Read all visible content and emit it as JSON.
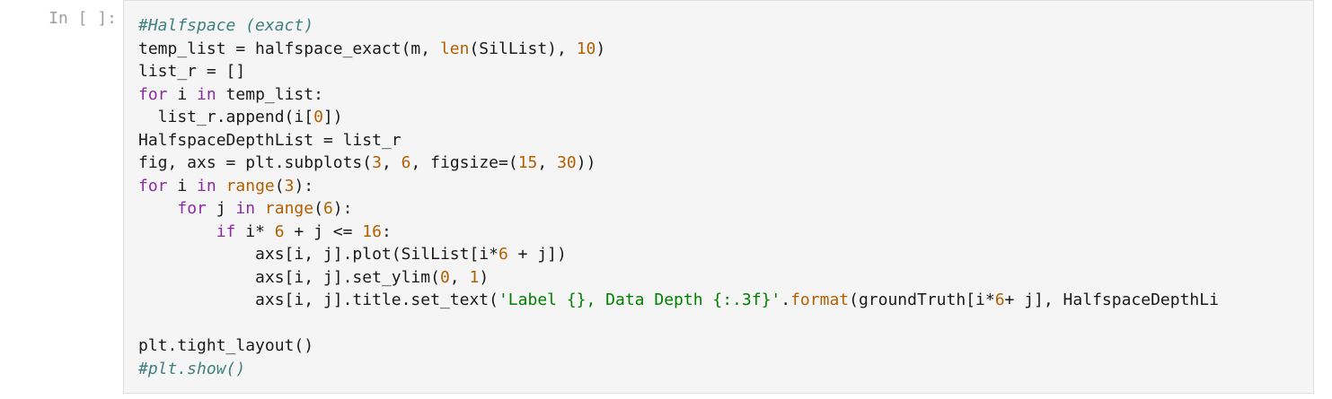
{
  "cell": {
    "prompt": "In [ ]:",
    "lines": [
      [
        {
          "t": "#Halfspace (exact)",
          "k": "comment"
        }
      ],
      [
        {
          "t": "temp_list = halfspace_exact(m, ",
          "k": "plain"
        },
        {
          "t": "len",
          "k": "builtin"
        },
        {
          "t": "(SilList), ",
          "k": "plain"
        },
        {
          "t": "10",
          "k": "number"
        },
        {
          "t": ")",
          "k": "plain"
        }
      ],
      [
        {
          "t": "list_r = []",
          "k": "plain"
        }
      ],
      [
        {
          "t": "for",
          "k": "keyword"
        },
        {
          "t": " i ",
          "k": "plain"
        },
        {
          "t": "in",
          "k": "keyword"
        },
        {
          "t": " temp_list:",
          "k": "plain"
        }
      ],
      [
        {
          "t": "  list_r.append(i[",
          "k": "plain"
        },
        {
          "t": "0",
          "k": "number"
        },
        {
          "t": "])",
          "k": "plain"
        }
      ],
      [
        {
          "t": "HalfspaceDepthList = list_r",
          "k": "plain"
        }
      ],
      [
        {
          "t": "fig, axs = plt.subplots(",
          "k": "plain"
        },
        {
          "t": "3",
          "k": "number"
        },
        {
          "t": ", ",
          "k": "plain"
        },
        {
          "t": "6",
          "k": "number"
        },
        {
          "t": ", figsize=(",
          "k": "plain"
        },
        {
          "t": "15",
          "k": "number"
        },
        {
          "t": ", ",
          "k": "plain"
        },
        {
          "t": "30",
          "k": "number"
        },
        {
          "t": "))",
          "k": "plain"
        }
      ],
      [
        {
          "t": "for",
          "k": "keyword"
        },
        {
          "t": " i ",
          "k": "plain"
        },
        {
          "t": "in",
          "k": "keyword"
        },
        {
          "t": " ",
          "k": "plain"
        },
        {
          "t": "range",
          "k": "builtin"
        },
        {
          "t": "(",
          "k": "plain"
        },
        {
          "t": "3",
          "k": "number"
        },
        {
          "t": "):",
          "k": "plain"
        }
      ],
      [
        {
          "t": "    ",
          "k": "plain"
        },
        {
          "t": "for",
          "k": "keyword"
        },
        {
          "t": " j ",
          "k": "plain"
        },
        {
          "t": "in",
          "k": "keyword"
        },
        {
          "t": " ",
          "k": "plain"
        },
        {
          "t": "range",
          "k": "builtin"
        },
        {
          "t": "(",
          "k": "plain"
        },
        {
          "t": "6",
          "k": "number"
        },
        {
          "t": "):",
          "k": "plain"
        }
      ],
      [
        {
          "t": "        ",
          "k": "plain"
        },
        {
          "t": "if",
          "k": "keyword"
        },
        {
          "t": " i* ",
          "k": "plain"
        },
        {
          "t": "6",
          "k": "number"
        },
        {
          "t": " + j <= ",
          "k": "plain"
        },
        {
          "t": "16",
          "k": "number"
        },
        {
          "t": ":",
          "k": "plain"
        }
      ],
      [
        {
          "t": "            axs[i, j].plot(SilList[i*",
          "k": "plain"
        },
        {
          "t": "6",
          "k": "number"
        },
        {
          "t": " + j])",
          "k": "plain"
        }
      ],
      [
        {
          "t": "            axs[i, j].set_ylim(",
          "k": "plain"
        },
        {
          "t": "0",
          "k": "number"
        },
        {
          "t": ", ",
          "k": "plain"
        },
        {
          "t": "1",
          "k": "number"
        },
        {
          "t": ")",
          "k": "plain"
        }
      ],
      [
        {
          "t": "            axs[i, j].title.set_text(",
          "k": "plain"
        },
        {
          "t": "'Label {}, Data Depth {:.3f}'",
          "k": "string"
        },
        {
          "t": ".",
          "k": "plain"
        },
        {
          "t": "format",
          "k": "builtin"
        },
        {
          "t": "(groundTruth[i*",
          "k": "plain"
        },
        {
          "t": "6",
          "k": "number"
        },
        {
          "t": "+ j], HalfspaceDepthLi",
          "k": "plain"
        }
      ],
      [],
      [
        {
          "t": "plt.tight_layout()",
          "k": "plain"
        }
      ],
      [
        {
          "t": "#plt.show()",
          "k": "comment"
        }
      ]
    ]
  }
}
